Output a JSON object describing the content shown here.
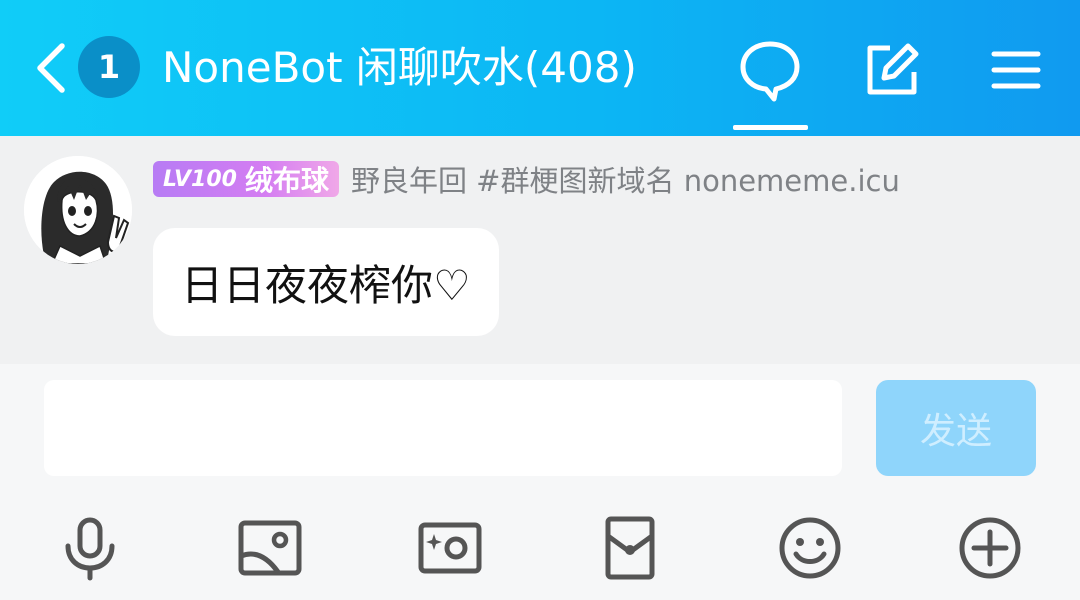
{
  "header": {
    "unread_count": "1",
    "title": "NoneBot 闲聊吹水(408)",
    "back_icon": "chevron-left-icon",
    "chat_icon": "chat-bubble-icon",
    "edit_icon": "edit-icon",
    "menu_icon": "menu-icon"
  },
  "message": {
    "level": "LV100",
    "nickname": "绒布球",
    "sender_title": "野良年回 #群梗图新域名 nonememe.icu",
    "text": "日日夜夜榨你♡"
  },
  "composer": {
    "input_value": "",
    "send_label": "发送",
    "tools": [
      "microphone-icon",
      "image-icon",
      "camera-icon",
      "red-packet-icon",
      "emoji-icon",
      "plus-icon"
    ]
  },
  "colors": {
    "header_gradient_start": "#10cdf8",
    "header_gradient_end": "#109af0",
    "send_button": "#8fd5fb",
    "level_badge": "#b77cf4"
  }
}
